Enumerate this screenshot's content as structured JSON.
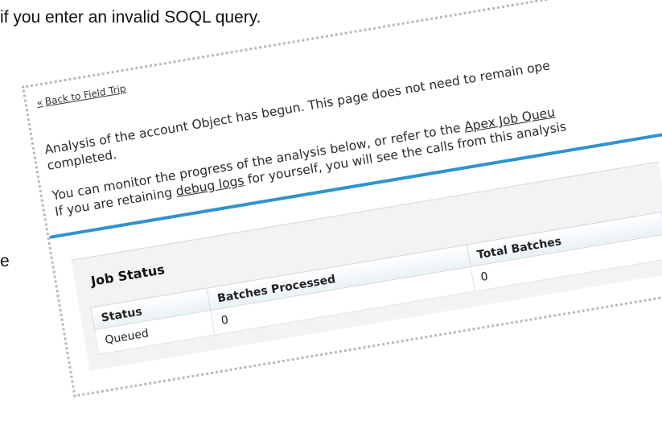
{
  "document": {
    "top_line": "if you enter an invalid SOQL query.",
    "left_fragment": "e"
  },
  "screenshot": {
    "back_link": "Back to Field Trip",
    "back_link_prefix": "«",
    "para1_text": "Analysis of the account Object has begun. This page does not need to remain ope",
    "para1_cont": "completed.",
    "para2_line1_text": "You can monitor the progress of the analysis below, or refer to the ",
    "para2_line1_link": "Apex Job Queu",
    "para2_line2_prefix": "If you are retaining ",
    "para2_line2_link": "debug logs",
    "para2_line2_suffix": " for yourself, you will see the calls from this analysis",
    "job_status": {
      "title": "Job Status",
      "columns": [
        "Status",
        "Batches Processed",
        "Total Batches"
      ],
      "rows": [
        [
          "Queued",
          "0",
          "0"
        ]
      ]
    }
  },
  "colors": {
    "accent_bar": "#2f93cf",
    "border_dotted": "#b9b9b9"
  }
}
